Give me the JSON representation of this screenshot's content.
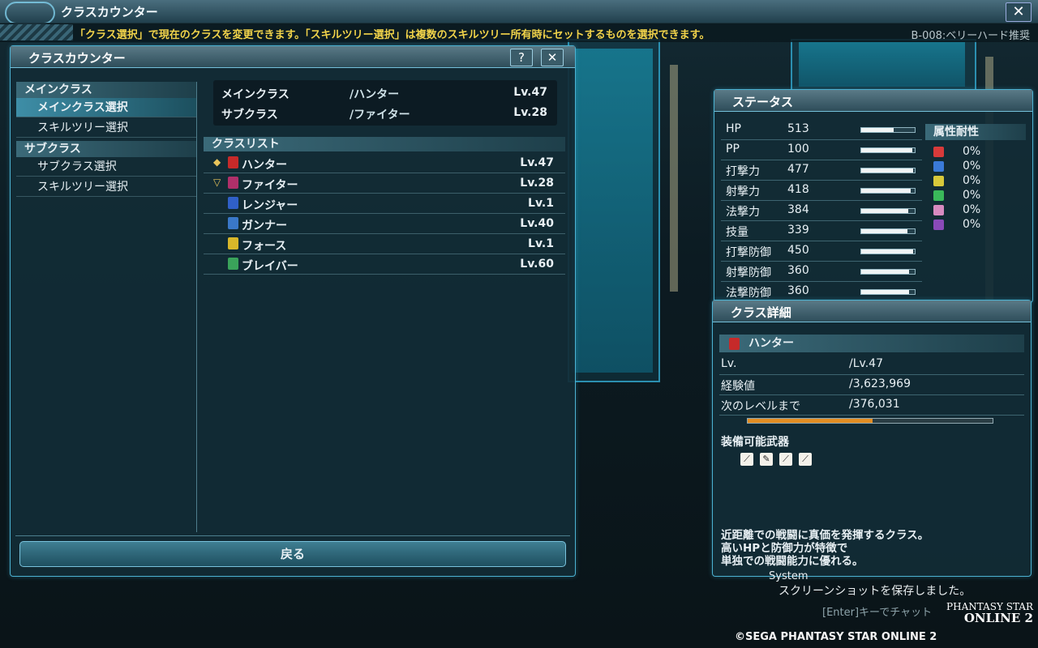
{
  "topbar": {
    "title": "クラスカウンター",
    "close_glyph": "✕"
  },
  "infobar": {
    "message": "「クラス選択」で現在のクラスを変更できます。「スキルツリー選択」は複数のスキルツリー所有時にセットするものを選択できます。",
    "location": "B-008:ベリーハード推奨"
  },
  "class_counter": {
    "title": "クラスカウンター",
    "help_glyph": "?",
    "close_glyph": "✕",
    "menu": {
      "main_header": "メインクラス",
      "main_items": [
        "メインクラス選択",
        "スキルツリー選択"
      ],
      "sub_header": "サブクラス",
      "sub_items": [
        "サブクラス選択",
        "スキルツリー選択"
      ]
    },
    "current": [
      {
        "label": "メインクラス",
        "sep": "/",
        "class": "ハンター",
        "level": "Lv.47"
      },
      {
        "label": "サブクラス",
        "sep": "/",
        "class": "ファイター",
        "level": "Lv.28"
      }
    ],
    "class_list_header": "クラスリスト",
    "classes": [
      {
        "name": "ハンター",
        "level": "Lv.47",
        "icon": "hunter-icon",
        "marker": "main-class-marker",
        "color": "#c62a2a"
      },
      {
        "name": "ファイター",
        "level": "Lv.28",
        "icon": "fighter-icon",
        "marker": "sub-class-marker",
        "color": "#b0306a"
      },
      {
        "name": "レンジャー",
        "level": "Lv.1",
        "icon": "ranger-icon",
        "marker": "",
        "color": "#3060c8"
      },
      {
        "name": "ガンナー",
        "level": "Lv.40",
        "icon": "gunner-icon",
        "marker": "",
        "color": "#3a78c8"
      },
      {
        "name": "フォース",
        "level": "Lv.1",
        "icon": "force-icon",
        "marker": "",
        "color": "#d8b72a"
      },
      {
        "name": "ブレイバー",
        "level": "Lv.60",
        "icon": "braver-icon",
        "marker": "",
        "color": "#3aa35a"
      }
    ],
    "back_label": "戻る"
  },
  "status": {
    "title": "ステータス",
    "stats": [
      {
        "name": "HP",
        "value": "513",
        "fill": 0.6
      },
      {
        "name": "PP",
        "value": "100",
        "fill": 0.95
      },
      {
        "name": "打撃力",
        "value": "477",
        "fill": 0.97
      },
      {
        "name": "射撃力",
        "value": "418",
        "fill": 0.92
      },
      {
        "name": "法撃力",
        "value": "384",
        "fill": 0.88
      },
      {
        "name": "技量",
        "value": "339",
        "fill": 0.86
      },
      {
        "name": "打撃防御",
        "value": "450",
        "fill": 0.97
      },
      {
        "name": "射撃防御",
        "value": "360",
        "fill": 0.9
      },
      {
        "name": "法撃防御",
        "value": "360",
        "fill": 0.9
      }
    ],
    "resist_title": "属性耐性",
    "resists": [
      {
        "icon": "fire-icon",
        "value": "0%",
        "color": "#d83a3a"
      },
      {
        "icon": "ice-icon",
        "value": "0%",
        "color": "#3a7ad8"
      },
      {
        "icon": "lightning-icon",
        "value": "0%",
        "color": "#d8c83a"
      },
      {
        "icon": "wind-icon",
        "value": "0%",
        "color": "#3ab85a"
      },
      {
        "icon": "light-icon",
        "value": "0%",
        "color": "#d88ac0"
      },
      {
        "icon": "dark-icon",
        "value": "0%",
        "color": "#8a4ab8"
      }
    ]
  },
  "detail": {
    "title": "クラス詳細",
    "class_name": "ハンター",
    "rows": [
      {
        "label": "Lv.",
        "sep": "/",
        "value": "Lv.47"
      },
      {
        "label": "経験値",
        "sep": "/",
        "value": "3,623,969"
      },
      {
        "label": "次のレベルまで",
        "sep": "/",
        "value": "376,031"
      }
    ],
    "exp_progress": 0.51,
    "weapons_label": "装備可能武器",
    "weapons": [
      "sword-icon",
      "wired-lance-icon",
      "partisan-icon",
      "twin-dagger-icon"
    ],
    "description": [
      "近距離での戦闘に真価を発揮するクラス。",
      "高いHPと防御力が特徴で",
      "単独での戦闘能力に優れる。"
    ]
  },
  "chat": {
    "lines": [
      "System",
      "スクリーンショットを保存しました。"
    ],
    "hint": "[Enter]キーでチャット"
  },
  "footer": {
    "copyright": "©SEGA PHANTASY STAR ONLINE 2",
    "logo_line1": "PHANTASY STAR",
    "logo_line2": "ONLINE 2"
  },
  "colors": {
    "accent": "#4cb2d2",
    "info_text": "#f1d34a",
    "exp_bar": "#e38d22"
  }
}
